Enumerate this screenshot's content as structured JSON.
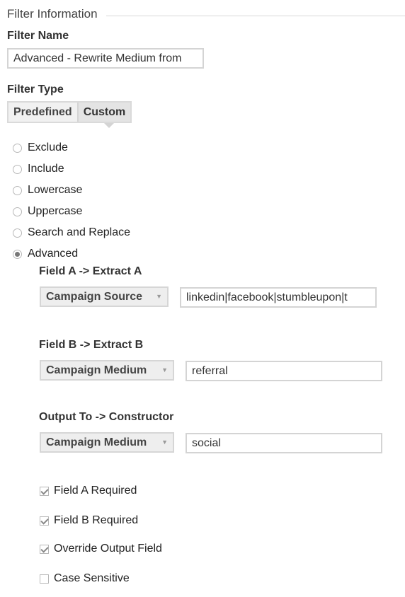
{
  "section": {
    "title": "Filter Information"
  },
  "filter_name": {
    "label": "Filter Name",
    "value": "Advanced - Rewrite Medium from"
  },
  "filter_type": {
    "label": "Filter Type",
    "tabs": [
      {
        "label": "Predefined",
        "active": false
      },
      {
        "label": "Custom",
        "active": true
      }
    ]
  },
  "custom_options": [
    {
      "label": "Exclude",
      "checked": false
    },
    {
      "label": "Include",
      "checked": false
    },
    {
      "label": "Lowercase",
      "checked": false
    },
    {
      "label": "Uppercase",
      "checked": false
    },
    {
      "label": "Search and Replace",
      "checked": false
    },
    {
      "label": "Advanced",
      "checked": true
    }
  ],
  "advanced": {
    "field_a": {
      "label": "Field A -> Extract A",
      "dropdown": "Campaign Source",
      "value": "linkedin|facebook|stumbleupon|t"
    },
    "field_b": {
      "label": "Field B -> Extract B",
      "dropdown": "Campaign Medium",
      "value": "referral"
    },
    "output": {
      "label": "Output To -> Constructor",
      "dropdown": "Campaign Medium",
      "value": "social"
    },
    "checkboxes": [
      {
        "label": "Field A Required",
        "checked": true
      },
      {
        "label": "Field B Required",
        "checked": true
      },
      {
        "label": "Override Output Field",
        "checked": true
      },
      {
        "label": "Case Sensitive",
        "checked": false
      }
    ]
  }
}
